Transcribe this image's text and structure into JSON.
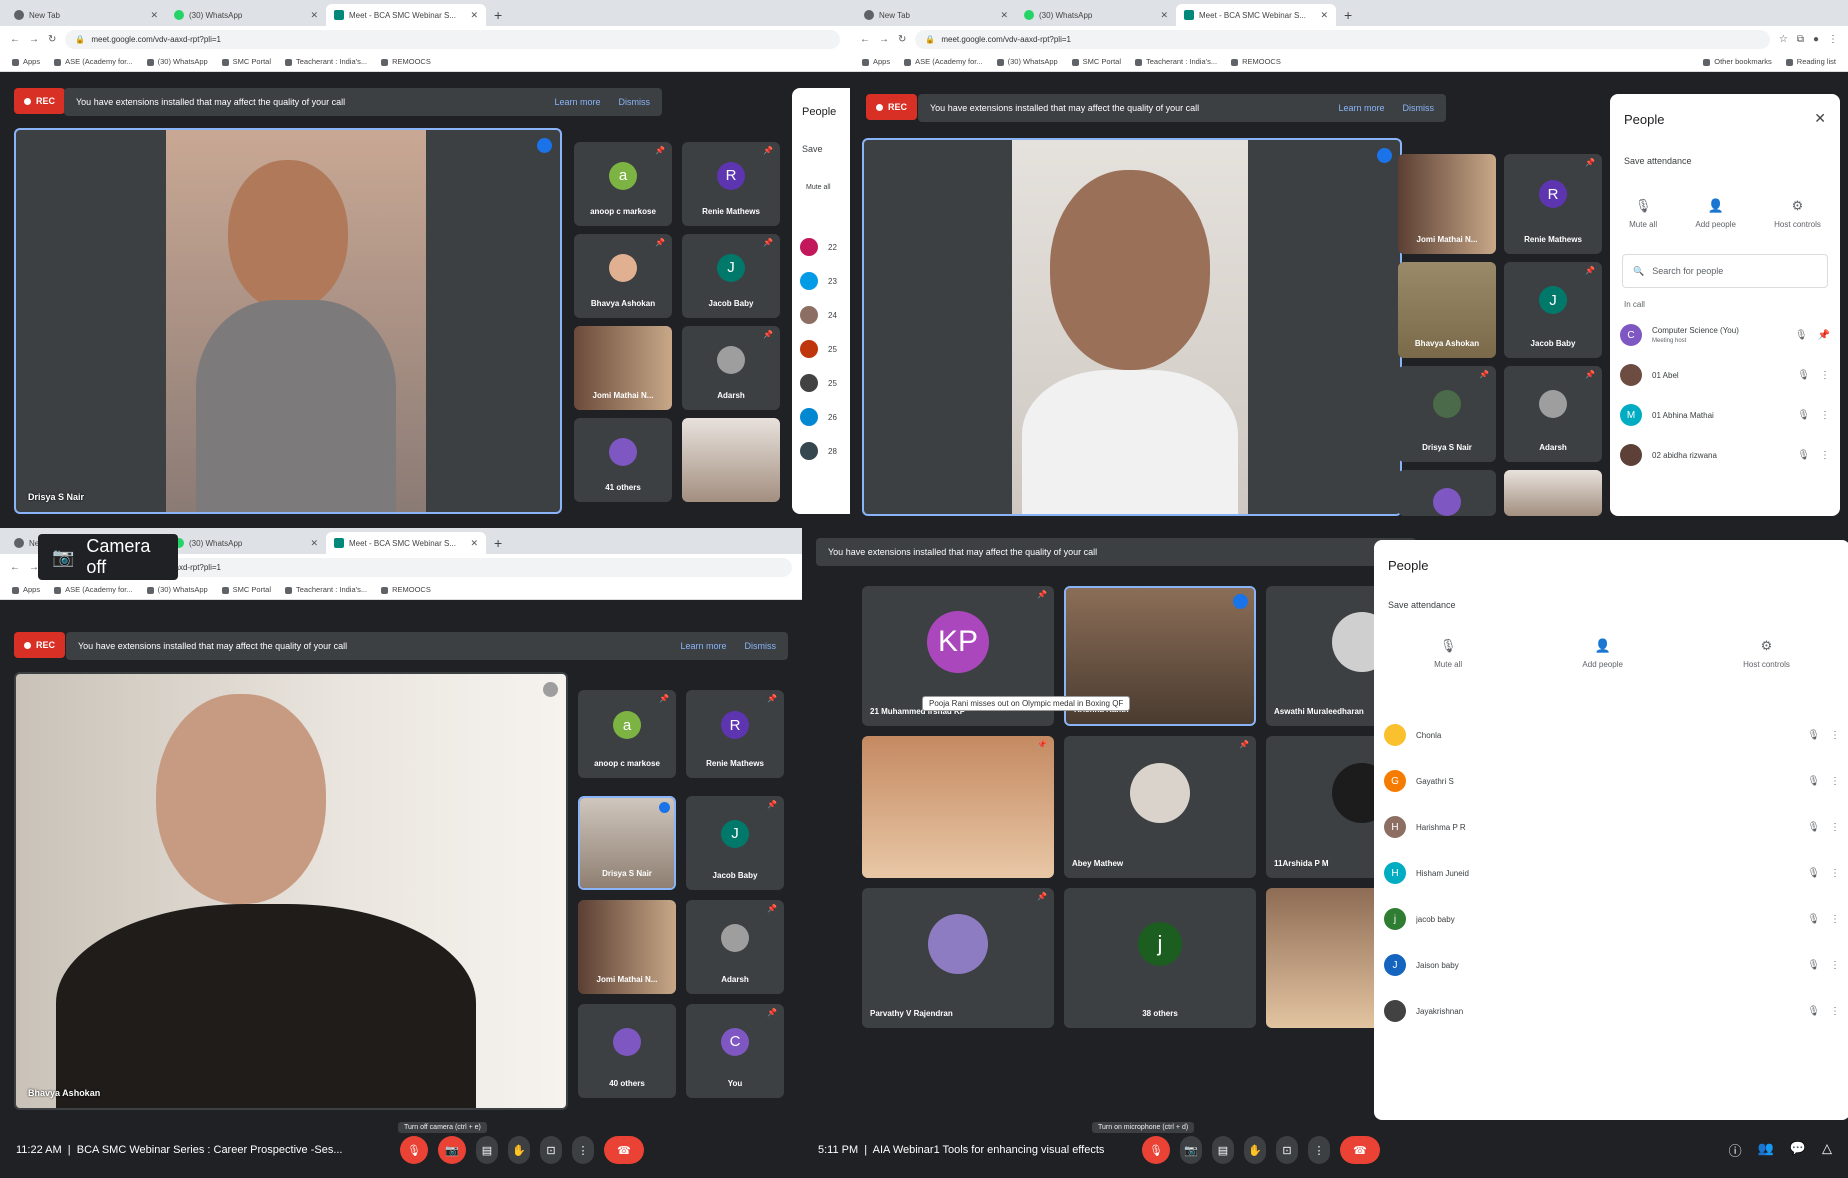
{
  "tabs": [
    {
      "title": "New Tab"
    },
    {
      "title": "(30) WhatsApp"
    },
    {
      "title": "Meet - BCA SMC Webinar S..."
    }
  ],
  "url": "meet.google.com/vdv-aaxd-rpt?pli=1",
  "bookmarks": [
    "Apps",
    "ASE (Academy for...",
    "(30) WhatsApp",
    "SMC Portal",
    "Teacherant : India's...",
    "REMOOCS"
  ],
  "bookmarks_right": [
    "Other bookmarks",
    "Reading list"
  ],
  "rec_label": "REC",
  "warning": {
    "text": "You have extensions installed that may affect the quality of your call",
    "learn": "Learn more",
    "dismiss": "Dismiss"
  },
  "shot1": {
    "main_name": "Drisya S Nair",
    "tiles": [
      "anoop c markose",
      "Renie Mathews",
      "Bhavya Ashokan",
      "Jacob Baby",
      "Jomi Mathai N...",
      "Adarsh",
      "41 others",
      ""
    ],
    "side_labels": {
      "people": "People",
      "save": "Save",
      "mute": "Mute all"
    },
    "side_numbers": [
      "22",
      "23",
      "24",
      "25",
      "25",
      "26",
      "28"
    ]
  },
  "shot2": {
    "tiles": [
      "Jomi Mathai N...",
      "Renie Mathews",
      "Bhavya Ashokan",
      "Jacob Baby",
      "Drisya S Nair",
      "Adarsh"
    ],
    "people": {
      "title": "People",
      "save": "Save attendance",
      "actions": [
        "Mute all",
        "Add people",
        "Host controls"
      ],
      "search": "Search for people",
      "in_call": "In call",
      "rows": [
        {
          "name": "Computer Science (You)",
          "sub": "Meeting host"
        },
        {
          "name": "01 Abel"
        },
        {
          "name": "01 Abhina Mathai"
        },
        {
          "name": "02 abidha rizwana"
        }
      ]
    }
  },
  "shot3": {
    "camera_off": "Camera off",
    "main_name": "Bhavya Ashokan",
    "tiles": [
      "anoop c markose",
      "Renie Mathews",
      "Drisya S Nair",
      "Jacob Baby",
      "Jomi Mathai N...",
      "Adarsh",
      "40 others",
      "You"
    ],
    "time": "11:22 AM",
    "meeting": "BCA SMC Webinar Series : Career Prospective -Ses...",
    "tooltip": "Turn off camera (ctrl + e)"
  },
  "shot4": {
    "tiles": [
      "21 Muhammed irshad KP",
      "Krishna Kanth",
      "Aswathi Muraleedharan",
      "",
      "Abey Mathew",
      "11Arshida P M",
      "Parvathy V Rajendran",
      "38 others",
      ""
    ],
    "caption": "Pooja Rani misses out on Olympic medal in Boxing QF",
    "time": "5:11 PM",
    "meeting": "AIA Webinar1 Tools for enhancing visual effects",
    "tooltip": "Turn on microphone (ctrl + d)",
    "people": {
      "title": "People",
      "save": "Save attendance",
      "actions": [
        "Mute all",
        "Add people",
        "Host controls"
      ],
      "rows": [
        "Chonla",
        "Gayathri S",
        "Harishma P R",
        "Hisham Juneid",
        "jacob baby",
        "Jaison baby",
        "Jayakrishnan"
      ]
    }
  }
}
